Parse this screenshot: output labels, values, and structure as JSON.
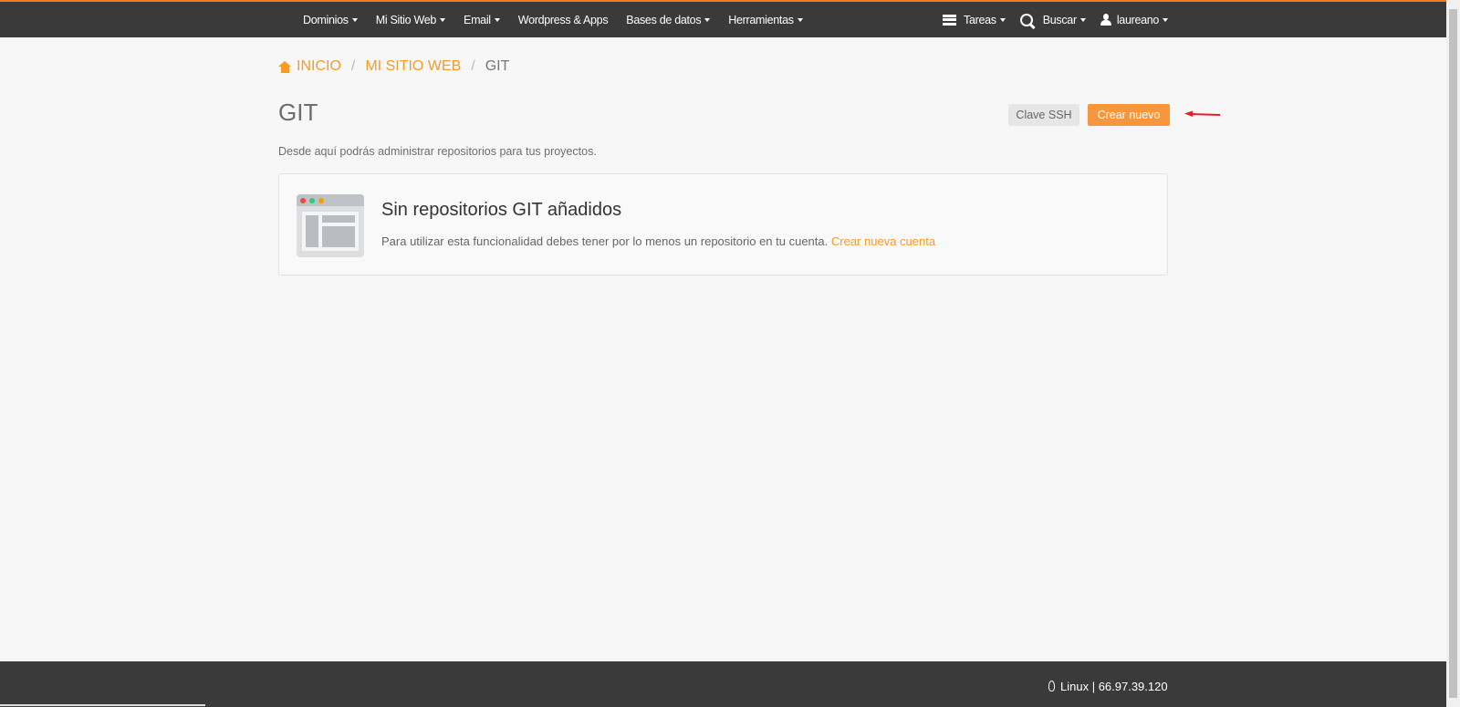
{
  "nav": {
    "items": [
      {
        "label": "Dominios",
        "dropdown": true
      },
      {
        "label": "Mi Sitio Web",
        "dropdown": true
      },
      {
        "label": "Email",
        "dropdown": true
      },
      {
        "label": "Wordpress & Apps",
        "dropdown": false
      },
      {
        "label": "Bases de datos",
        "dropdown": true
      },
      {
        "label": "Herramientas",
        "dropdown": true
      }
    ],
    "tasks_label": "Tareas",
    "search_label": "Buscar",
    "user_label": "laureano"
  },
  "breadcrumb": {
    "home": "INICIO",
    "section": "MI SITIO WEB",
    "current": "GIT"
  },
  "page": {
    "title": "GIT",
    "description": "Desde aquí podrás administrar repositorios para tus proyectos.",
    "ssh_button": "Clave SSH",
    "new_button": "Crear nuevo"
  },
  "empty_state": {
    "title": "Sin repositorios GIT añadidos",
    "text": "Para utilizar esta funcionalidad debes tener por lo menos un repositorio en tu cuenta.",
    "link": "Crear nueva cuenta"
  },
  "footer": {
    "os": "Linux",
    "ip": "66.97.39.120"
  },
  "colors": {
    "accent": "#f89b24",
    "topbar": "#3a3a3a",
    "annotation_arrow": "#e0202a"
  }
}
